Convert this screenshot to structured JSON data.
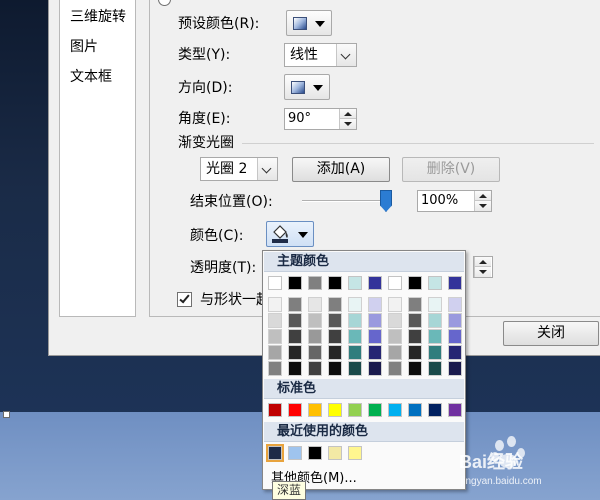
{
  "sidebar": {
    "items": [
      "三维旋转",
      "图片",
      "文本框"
    ]
  },
  "form": {
    "preset_label": "预设颜色(R):",
    "type_label": "类型(Y):",
    "type_value": "线性",
    "direction_label": "方向(D):",
    "angle_label": "角度(E):",
    "angle_value": "90°",
    "gradient_stops_label": "渐变光圈",
    "stop_value": "光圈 2",
    "add_button": "添加(A)",
    "delete_button": "删除(V)",
    "end_position_label": "结束位置(O):",
    "end_position_value": "100%",
    "end_position_fraction": 1.0,
    "color_label": "颜色(C):",
    "transparency_label": "透明度(T):",
    "rotate_with_shape_label": "与形状一起",
    "rotate_with_shape_checked": true
  },
  "dialog": {
    "close_button": "关闭"
  },
  "color_popup": {
    "theme_colors_label": "主题颜色",
    "standard_colors_label": "标准色",
    "recent_colors_label": "最近使用的颜色",
    "more_colors_label": "其他颜色(M)...",
    "theme_top_row": [
      "#ffffff",
      "#000000",
      "#808080",
      "#000000",
      "#c5e5e5",
      "#33339a",
      "#ffffff",
      "#000000",
      "#c5e5e5",
      "#33339a"
    ],
    "theme_shades": [
      [
        "#f2f2f2",
        "#d9d9d9",
        "#bfbfbf",
        "#a6a6a6",
        "#808080"
      ],
      [
        "#7f7f7f",
        "#595959",
        "#404040",
        "#262626",
        "#0d0d0d"
      ],
      [
        "#e6e6e6",
        "#bfbfbf",
        "#999999",
        "#666666",
        "#404040"
      ],
      [
        "#7f7f7f",
        "#595959",
        "#404040",
        "#262626",
        "#0d0d0d"
      ],
      [
        "#e8f4f4",
        "#a7d6d6",
        "#6ab8b8",
        "#2f7d7d",
        "#1a4a4a"
      ],
      [
        "#d0d0ef",
        "#9a9ade",
        "#6666cc",
        "#262673",
        "#1a1a4d"
      ],
      [
        "#f2f2f2",
        "#d9d9d9",
        "#bfbfbf",
        "#a6a6a6",
        "#808080"
      ],
      [
        "#7f7f7f",
        "#595959",
        "#404040",
        "#262626",
        "#0d0d0d"
      ],
      [
        "#e8f4f4",
        "#a7d6d6",
        "#6ab8b8",
        "#2f7d7d",
        "#1a4a4a"
      ],
      [
        "#d0d0ef",
        "#9a9ade",
        "#6666cc",
        "#262673",
        "#1a1a4d"
      ]
    ],
    "standard_colors": [
      "#c00000",
      "#ff0000",
      "#ffc000",
      "#ffff00",
      "#92d050",
      "#00b050",
      "#00b0f0",
      "#0070c0",
      "#002060",
      "#7030a0"
    ],
    "recent_colors": [
      "#1f2b47",
      "#9fc4ee",
      "#000000",
      "#f3e9a5",
      "#fff68f"
    ]
  },
  "tooltip": "深蓝",
  "watermark": {
    "brand": "Bai经验",
    "url": "jingyan.baidu.com"
  }
}
